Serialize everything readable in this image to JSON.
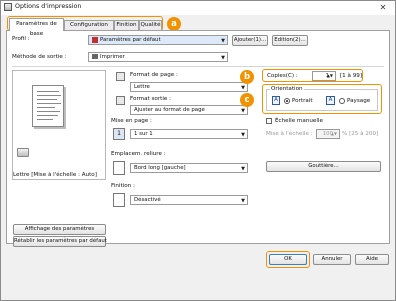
{
  "window": {
    "title": "Options d'impression",
    "close": "✕"
  },
  "tabs": [
    {
      "label": "Paramètres de base"
    },
    {
      "label": "Configuration page"
    },
    {
      "label": "Finition"
    },
    {
      "label": "Qualité"
    }
  ],
  "callouts": {
    "a": "a",
    "b": "b",
    "c": "c"
  },
  "profile": {
    "label": "Profil :",
    "value": "Paramètres par défaut",
    "add_button": "Ajouter(1)...",
    "edit_button": "Edition(2)..."
  },
  "output_method": {
    "label": "Méthode de sortie :",
    "value": "Imprimer"
  },
  "page_format": {
    "label": "Format de page :",
    "value": "Lettre"
  },
  "output_format": {
    "label": "Format sortie :",
    "value": "Ajuster au format de page"
  },
  "copies": {
    "label": "Copies(C) :",
    "value": "1",
    "range": "[1 à 99]"
  },
  "orientation": {
    "label": "Orientation",
    "portrait": "Portrait",
    "landscape": "Paysage",
    "selected": "portrait"
  },
  "layout": {
    "label": "Mise en page :",
    "value": "1 sur 1"
  },
  "manual_scale": {
    "label": "Échelle manuelle",
    "scale_label": "Mise à l'échelle :",
    "scale_value": "100",
    "scale_range": "% [25 à 200]"
  },
  "binding": {
    "label": "Emplacem. reliure :",
    "value": "Bord long [gauche]",
    "gutter_button": "Gouttière..."
  },
  "finishing": {
    "label": "Finition :",
    "value": "Désactivé"
  },
  "preview": {
    "caption": "Lettre [Mise à l'échelle : Auto]"
  },
  "left_buttons": {
    "show_settings": "Affichage des paramètres",
    "restore_defaults": "Rétablir les paramètres par défaut"
  },
  "footer": {
    "ok": "OK",
    "cancel": "Annuler",
    "help": "Aide"
  },
  "colors": {
    "accent": "#f39200"
  }
}
